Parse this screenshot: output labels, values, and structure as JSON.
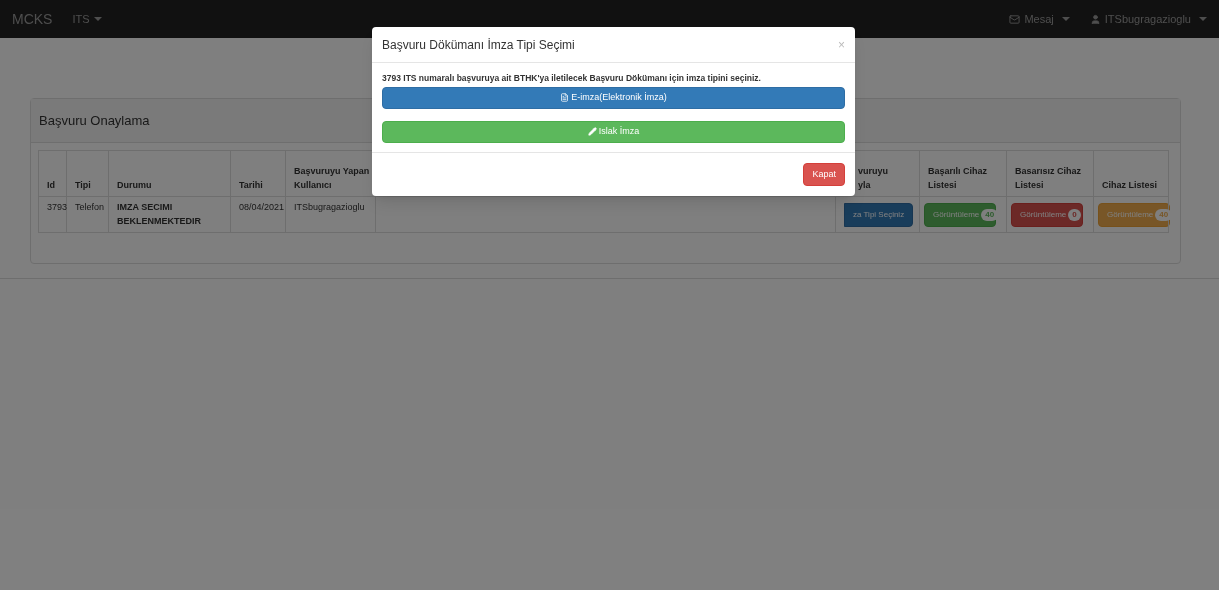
{
  "navbar": {
    "brand": "MCKS",
    "menu": "ITS",
    "right": [
      {
        "kind": "message",
        "label": "Mesaj"
      },
      {
        "kind": "user",
        "label": "ITSbugragazioglu"
      }
    ]
  },
  "panel": {
    "title": "Başvuru Onaylama",
    "columns": [
      "Id",
      "Tipi",
      "Durumu",
      "Tarihi",
      "Başvuruyu Yapan Kullanıcı",
      "vuruyu yla",
      "Başarılı Cihaz Listesi",
      "Basarısız Cihaz Listesi",
      "Cihaz Listesi"
    ],
    "row": {
      "id": "3793",
      "type": "Telefon",
      "status": "IMZA SECIMI BEKLENMEKTEDIR",
      "date": "08/04/2021",
      "user": "ITSbugragazioglu",
      "actions": [
        {
          "kind": "primary",
          "label": "za Tipi Seçiniz"
        },
        {
          "kind": "success",
          "label": "Görüntüleme",
          "count": "40"
        },
        {
          "kind": "danger",
          "label": "Görüntüleme",
          "count": "0"
        },
        {
          "kind": "warning",
          "label": "Görüntüleme",
          "count": "40"
        }
      ]
    }
  },
  "modal": {
    "title": "Başvuru Dökümanı İmza Tipi Seçimi",
    "close": "×",
    "message": "3793 ITS numaralı başvuruya ait BTHK'ya iletilecek Başvuru Dökümanı için imza tipini seçiniz.",
    "options": [
      {
        "kind": "primary",
        "label": "E-imza(Elektronik İmza)"
      },
      {
        "kind": "success",
        "label": "Islak İmza"
      }
    ],
    "footer_button": "Kapat"
  }
}
